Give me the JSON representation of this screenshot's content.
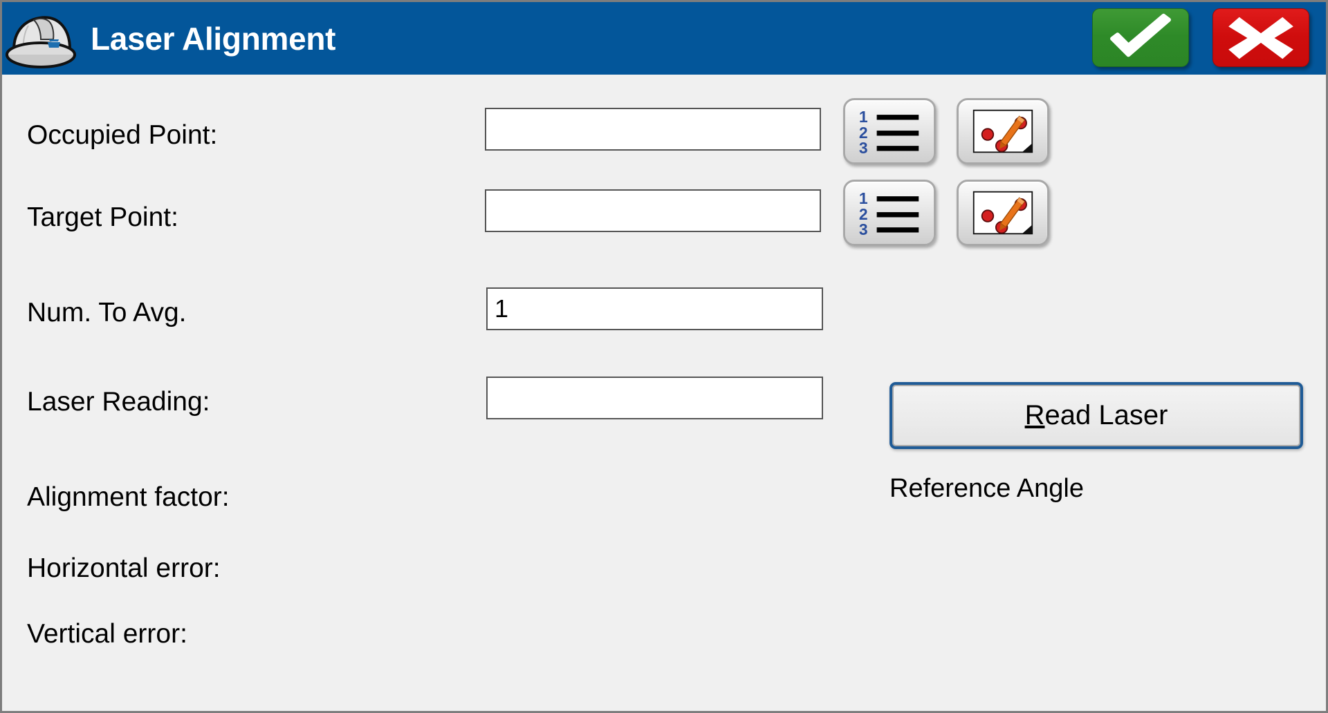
{
  "window": {
    "title": "Laser Alignment",
    "app_icon": "hard-hat-icon",
    "titlebar_color": "#03569A",
    "body_color": "#F0F0F0"
  },
  "titlebar_buttons": {
    "accept": {
      "icon": "checkmark-icon",
      "color": "#2E8A28",
      "label": ""
    },
    "cancel": {
      "icon": "x-mark-icon",
      "color": "#CF0D0D",
      "label": ""
    }
  },
  "form": {
    "rows": [
      {
        "label": "Occupied Point:",
        "value": "",
        "has_list_button": true,
        "has_map_button": true,
        "list_icon": "numbered-list-icon",
        "map_icon": "map-pick-point-icon"
      },
      {
        "label": "Target Point:",
        "value": "",
        "has_list_button": true,
        "has_map_button": true,
        "list_icon": "numbered-list-icon",
        "map_icon": "map-pick-point-icon"
      },
      {
        "label": "Num. To Avg.",
        "value": "1",
        "has_list_button": false,
        "has_map_button": false
      },
      {
        "label": "Laser Reading:",
        "value": "",
        "has_list_button": false,
        "has_map_button": false
      }
    ],
    "readouts": [
      {
        "label": "Alignment factor:",
        "value": ""
      },
      {
        "label": "Horizontal error:",
        "value": ""
      },
      {
        "label": "Vertical error:",
        "value": ""
      }
    ]
  },
  "actions": {
    "read_laser": {
      "label": "Read Laser",
      "accelerator": "R"
    },
    "reference_angle_label": "Reference Angle"
  },
  "list_icon_digits": [
    "1",
    "2",
    "3"
  ]
}
